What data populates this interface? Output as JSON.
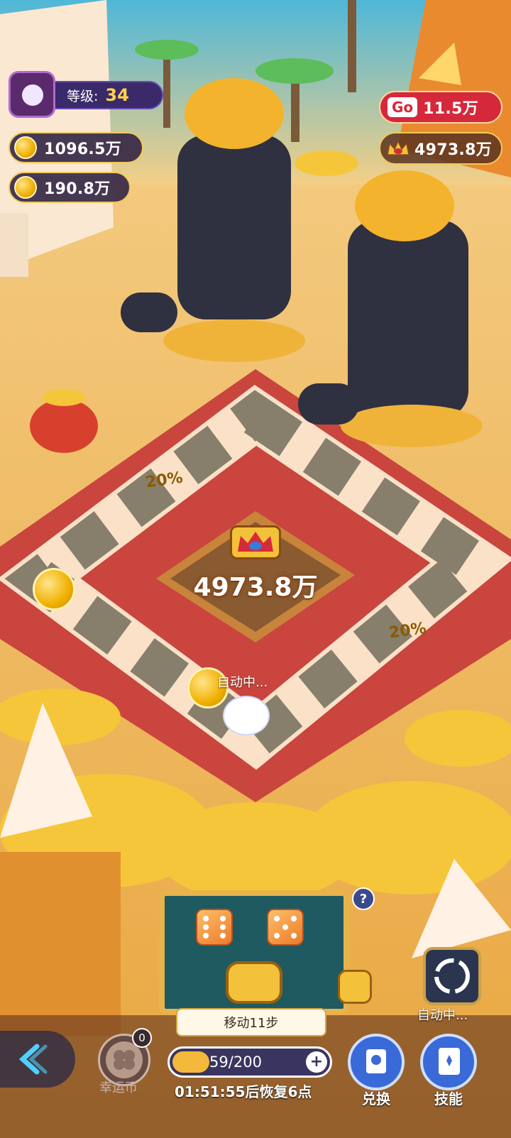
{
  "hud": {
    "level_label": "等级:",
    "level_value": "34",
    "coins_primary": "1096.5万",
    "coins_secondary": "190.8万",
    "go_tag": "Go",
    "go_value": "11.5万",
    "crown_value": "4973.8万"
  },
  "board": {
    "jackpot": "4973.8万",
    "status": "自动中...",
    "tile_label": "20%"
  },
  "dice": {
    "move_text": "移动11步",
    "help": "?"
  },
  "bottom": {
    "lucky_count": "0",
    "lucky_label": "幸运币",
    "energy_text": "59/200",
    "energy_fraction": 0.295,
    "recover_text": "01:51:55后恢复6点",
    "exchange_label": "兑换",
    "skill_label": "技能",
    "auto_label": "自动中..."
  },
  "colors": {
    "accent_red": "#d6283b",
    "gold": "#f0c95a",
    "board_red": "#c9453e"
  }
}
